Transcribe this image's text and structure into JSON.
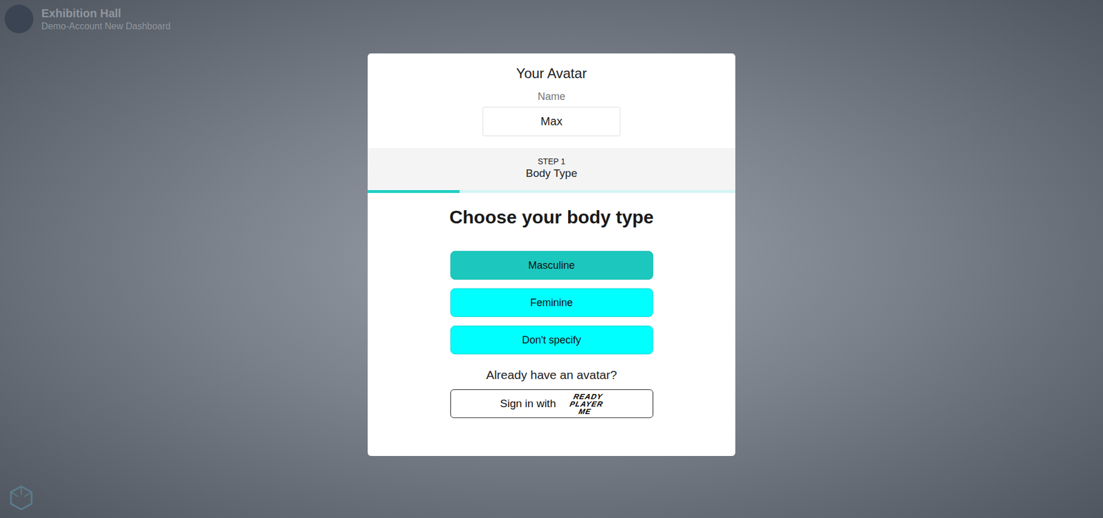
{
  "header": {
    "title": "Exhibition Hall",
    "subtitle": "Demo-Account New Dashboard"
  },
  "dialog": {
    "title": "Your Avatar",
    "name_label": "Name",
    "name_value": "Max",
    "step": {
      "number": "STEP 1",
      "title": "Body Type",
      "level": 0.25
    },
    "heading": "Choose your body type",
    "options": [
      {
        "label": "Masculine",
        "selected": true
      },
      {
        "label": "Feminine",
        "selected": false
      },
      {
        "label": "Don't specify",
        "selected": false
      }
    ],
    "signin_prompt": "Already have an avatar?",
    "signin": {
      "label": "Sign in with",
      "logo": [
        "READY",
        "PLAYER",
        "ME"
      ]
    }
  }
}
